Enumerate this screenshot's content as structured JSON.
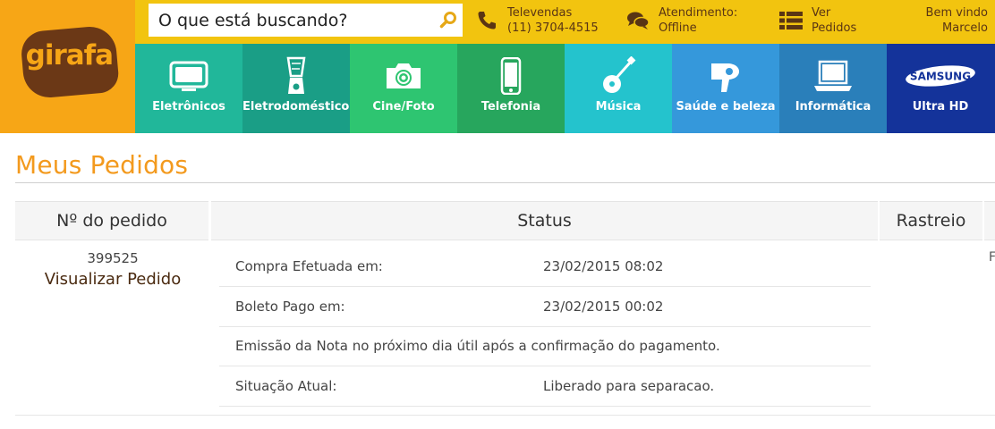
{
  "brand": {
    "logo_text": "girafa",
    "orange": "#f7a616",
    "brown": "#6b3816",
    "yellow": "#f2c40f"
  },
  "search": {
    "placeholder": "O que está buscando?",
    "icon": "search-icon"
  },
  "topbar": {
    "televendas": {
      "line1": "Televendas",
      "line2": "(11) 3704-4515",
      "icon": "phone-icon"
    },
    "atendimento": {
      "line1": "Atendimento:",
      "line2": "Offline",
      "icon": "chat-bubbles-icon"
    },
    "pedidos": {
      "line1": "Ver",
      "line2": "Pedidos",
      "icon": "list-icon"
    },
    "welcome": {
      "line1": "Bem vindo",
      "line2": "Marcelo"
    }
  },
  "categories": [
    {
      "label": "Eletrônicos",
      "icon": "tv-icon",
      "color": "#21b79a"
    },
    {
      "label": "Eletrodomésticos",
      "icon": "blender-icon",
      "color": "#1a9e86"
    },
    {
      "label": "Cine/Foto",
      "icon": "camera-icon",
      "color": "#2ec571"
    },
    {
      "label": "Telefonia",
      "icon": "smartphone-icon",
      "color": "#27a65d"
    },
    {
      "label": "Música",
      "icon": "guitar-icon",
      "color": "#24c3cd"
    },
    {
      "label": "Saúde e beleza",
      "icon": "hair-dryer-icon",
      "color": "#3598db"
    },
    {
      "label": "Informática",
      "icon": "laptop-icon",
      "color": "#2a7fba"
    },
    {
      "label": "Ultra HD",
      "brand_text": "SAMSUNG",
      "icon": "samsung-logo-icon",
      "color": "#14339a"
    }
  ],
  "page": {
    "title": "Meus Pedidos",
    "columns": {
      "order": "Nº do pedido",
      "status": "Status",
      "tracking": "Rastreio"
    }
  },
  "order": {
    "number": "399525",
    "view_label": "Visualizar Pedido",
    "status_rows": [
      {
        "label": "Compra Efetuada em:",
        "value": "23/02/2015 08:02"
      },
      {
        "label": "Boleto Pago em:",
        "value": "23/02/2015 00:02"
      },
      {
        "label": "Emissão da Nota no próximo dia útil após a confirmação do pagamento.",
        "value": ""
      },
      {
        "label": "Situação Atual:",
        "value": "Liberado para separacao."
      }
    ],
    "tracking_cut_text": "F"
  }
}
